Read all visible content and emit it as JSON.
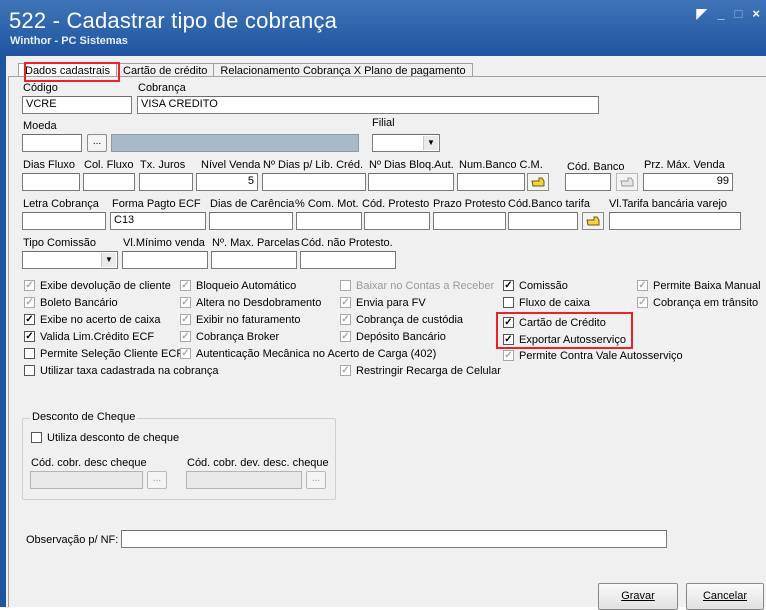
{
  "window": {
    "title": "522 - Cadastrar tipo de cobrança",
    "subtitle": "Winthor - PC Sistemas",
    "minimize": "_",
    "restore": "□",
    "close": "×",
    "app_icon": "window-icon"
  },
  "tabs": [
    "Dados cadastrais",
    "Cartão de crédito",
    "Relacionamento Cobrança X Plano de pagamento"
  ],
  "fields": {
    "codigo": {
      "label": "Código",
      "value": "VCRE"
    },
    "cobranca": {
      "label": "Cobrança",
      "value": "VISA CREDITO"
    },
    "moeda": {
      "label": "Moeda",
      "value": "",
      "button": "..."
    },
    "filial": {
      "label": "Filial",
      "value": ""
    },
    "dias_fluxo": {
      "label": "Dias Fluxo",
      "value": ""
    },
    "col_fluxo": {
      "label": "Col. Fluxo",
      "value": ""
    },
    "tx_juros": {
      "label": "Tx. Juros",
      "value": ""
    },
    "nivel_venda": {
      "label": "Nível Venda",
      "value": "5"
    },
    "dias_lib_cred": {
      "label": "Nº Dias p/ Lib. Créd.",
      "value": ""
    },
    "dias_bloq_aut": {
      "label": "Nº Dias Bloq.Aut.",
      "value": ""
    },
    "num_banco_cm": {
      "label": "Num.Banco C.M.",
      "value": ""
    },
    "cod_banco": {
      "label": "Cód. Banco",
      "value": ""
    },
    "prz_max_venda": {
      "label": "Prz. Máx. Venda",
      "value": "99"
    },
    "letra_cobranca": {
      "label": "Letra Cobrança",
      "value": ""
    },
    "forma_pagto_ecf": {
      "label": "Forma Pagto ECF",
      "value": "C13"
    },
    "dias_carencia": {
      "label": "Dias de Carência",
      "value": ""
    },
    "com_mot": {
      "label": "% Com. Mot.",
      "value": ""
    },
    "cod_protesto": {
      "label": "Cód. Protesto",
      "value": ""
    },
    "prazo_protesto": {
      "label": "Prazo Protesto",
      "value": ""
    },
    "cod_banco_tarifa": {
      "label": "Cód.Banco tarifa",
      "value": ""
    },
    "vl_tarifa": {
      "label": "Vl.Tarifa bancária varejo",
      "value": ""
    },
    "tipo_comissao": {
      "label": "Tipo Comissão",
      "value": ""
    },
    "vl_minimo_venda": {
      "label": "Vl.Mínimo venda",
      "value": ""
    },
    "max_parcelas": {
      "label": "Nº. Max. Parcelas",
      "value": ""
    },
    "cod_nao_protesto": {
      "label": "Cód. não Protesto.",
      "value": ""
    }
  },
  "checkboxes": {
    "col1": [
      {
        "label": "Exibe devolução de cliente",
        "checked": "✓",
        "style": "gray"
      },
      {
        "label": "Boleto Bancário",
        "checked": "✓",
        "style": "gray"
      },
      {
        "label": "Exibe no acerto de caixa",
        "checked": "✓",
        "style": "dark"
      },
      {
        "label": "Valida Lim.Crédito ECF",
        "checked": "✓",
        "style": "dark"
      },
      {
        "label": "Permite Seleção Cliente ECF",
        "checked": "",
        "style": "dark"
      },
      {
        "label": "Utilizar taxa cadastrada na cobrança",
        "checked": "",
        "style": "dark"
      }
    ],
    "col2": [
      {
        "label": "Bloqueio Automático",
        "checked": "✓",
        "style": "gray"
      },
      {
        "label": "Altera no Desdobramento",
        "checked": "✓",
        "style": "gray"
      },
      {
        "label": "Exibir no faturamento",
        "checked": "✓",
        "style": "gray"
      },
      {
        "label": "Cobrança Broker",
        "checked": "✓",
        "style": "gray"
      },
      {
        "label": "Autenticação Mecânica no Acerto de Carga (402)",
        "checked": "✓",
        "style": "gray"
      }
    ],
    "col3": [
      {
        "label": "Baixar no Contas a Receber",
        "checked": "",
        "style": "disabled"
      },
      {
        "label": "Envia para FV",
        "checked": "✓",
        "style": "gray"
      },
      {
        "label": "Cobrança de custódia",
        "checked": "✓",
        "style": "gray"
      },
      {
        "label": "Depósito Bancário",
        "checked": "✓",
        "style": "gray"
      },
      {
        "label": "Restringir Recarga de Celular",
        "checked": "✓",
        "style": "gray"
      }
    ],
    "col4": [
      {
        "label": "Comissão",
        "checked": "✓",
        "style": "dark"
      },
      {
        "label": "Fluxo de caixa",
        "checked": "",
        "style": "dark"
      },
      {
        "label": "Cartão de Crédito",
        "checked": "✓",
        "style": "dark"
      },
      {
        "label": "Exportar Autosserviço",
        "checked": "✓",
        "style": "dark"
      },
      {
        "label": "Permite Contra Vale Autosserviço",
        "checked": "✓",
        "style": "gray"
      }
    ],
    "col5": [
      {
        "label": "Permite Baixa Manual",
        "checked": "✓",
        "style": "gray"
      },
      {
        "label": "Cobrança em trânsito",
        "checked": "✓",
        "style": "gray"
      }
    ]
  },
  "desconto_cheque": {
    "title": "Desconto de Cheque",
    "utiliza_label": "Utiliza desconto de cheque",
    "utiliza_checked": "",
    "cod_cobr_label": "Cód. cobr. desc cheque",
    "cod_cobr_dev_label": "Cód. cobr. dev. desc. cheque",
    "button": "..."
  },
  "observacao": {
    "label": "Observação p/ NF:",
    "value": ""
  },
  "buttons": {
    "gravar": "Gravar",
    "cancelar": "Cancelar"
  },
  "accent_colors": {
    "titlebar": "#1f55a0",
    "highlight": "#e8242a"
  }
}
